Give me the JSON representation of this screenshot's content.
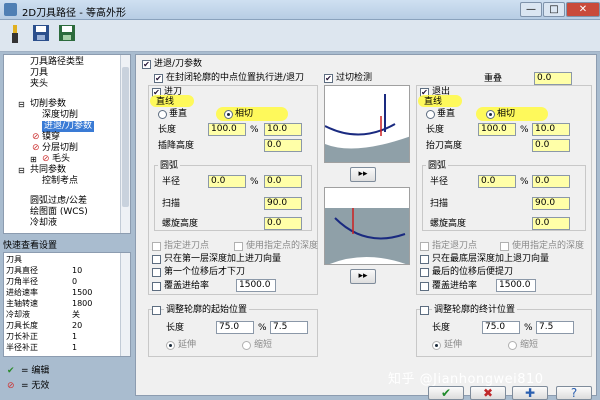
{
  "window": {
    "title": "2D刀具路径 - 等高外形",
    "min": "—",
    "max": "□",
    "close": "✕"
  },
  "tree": {
    "items": [
      {
        "label": "刀具路径类型"
      },
      {
        "label": "刀具"
      },
      {
        "label": "夹头"
      },
      {
        "label": "切削参数"
      },
      {
        "label": "深度切削"
      },
      {
        "label": "进退/刀参数"
      },
      {
        "label": "镆穿"
      },
      {
        "label": "分层切削"
      },
      {
        "label": "毛头"
      },
      {
        "label": "共同参数"
      },
      {
        "label": "控制考点"
      },
      {
        "label": "圆弧过虑/公差"
      },
      {
        "label": "绘图面 (WCS)"
      },
      {
        "label": "冷却液"
      }
    ]
  },
  "quick": {
    "header": "快速查看设置",
    "rows": [
      {
        "k": "刀具",
        "v": ""
      },
      {
        "k": "刀具直径",
        "v": "10"
      },
      {
        "k": "刀角半径",
        "v": "0"
      },
      {
        "k": "进给速率",
        "v": "1500"
      },
      {
        "k": "主轴转速",
        "v": "1800"
      },
      {
        "k": "冷却液",
        "v": "关"
      },
      {
        "k": "刀具长度",
        "v": "20"
      },
      {
        "k": "刀长补正",
        "v": "1"
      },
      {
        "k": "半径补正",
        "v": "1"
      }
    ]
  },
  "legend": {
    "edit": "= 编辑",
    "invalid": "= 无效"
  },
  "main": {
    "enable": "进退/刀参数",
    "midpoint": "在封闭轮廓的中点位置执行进/退刀",
    "overcut_check": "过切检测",
    "overlap_label": "重叠",
    "overlap": "0.0",
    "entry": {
      "title": "进刀",
      "line_group": "直线",
      "vertical": "垂直",
      "tangent": "相切",
      "length_label": "长度",
      "length_pct": "100.0",
      "length_val": "10.0",
      "ramp_label": "插降高度",
      "ramp": "0.0",
      "arc_group": "圆弧",
      "radius_label": "半径",
      "radius_pct": "0.0",
      "radius_val": "0.0",
      "sweep_label": "扫描",
      "sweep": "90.0",
      "helix_label": "螺旋高度",
      "helix": "0.0",
      "specify_point": "指定进刀点",
      "use_point_depth": "使用指定点的深度",
      "first_depth_only": "只在第一层深度加上进刀向量",
      "first_offset": "第一个位移后才下刀",
      "override_feed": "覆盖进给率",
      "feed": "1500.0",
      "pct": "%"
    },
    "exit": {
      "title": "退出",
      "line_group": "直线",
      "vertical": "垂直",
      "tangent": "相切",
      "length_label": "长度",
      "length_pct": "100.0",
      "length_val": "10.0",
      "ramp_label": "抬刀高度",
      "ramp": "0.0",
      "arc_group": "圆弧",
      "radius_label": "半径",
      "radius_pct": "0.0",
      "radius_val": "0.0",
      "sweep_label": "扫描",
      "sweep": "90.0",
      "helix_label": "螺旋高度",
      "helix": "0.0",
      "specify_point": "指定退刀点",
      "use_point_depth": "使用指定点的深度",
      "last_depth_only": "只在最底层深度加上退刀向量",
      "last_offset": "最后的位移后便提刀",
      "override_feed": "覆盖进给率",
      "feed": "1500.0",
      "pct": "%"
    },
    "copy_right": "▸▸",
    "copy_left": "▸▸",
    "adjust_start": {
      "label": "调整轮廓的起始位置",
      "length_label": "长度",
      "pct": "75.0",
      "val": "7.5",
      "extend": "延伸",
      "shorten": "缩短",
      "pct_sign": "%"
    },
    "adjust_end": {
      "label": "调整轮廓的终计位置",
      "length_label": "长度",
      "pct": "75.0",
      "val": "7.5",
      "extend": "延伸",
      "shorten": "缩短",
      "pct_sign": "%"
    }
  },
  "buttons": {
    "ok": "✔",
    "cancel": "✖",
    "help": "?"
  },
  "watermark": "知乎 @Jianhongwei810",
  "colors": {
    "highlight": "#fff94a",
    "field": "#ffffa8",
    "title": "#b7cde4"
  }
}
